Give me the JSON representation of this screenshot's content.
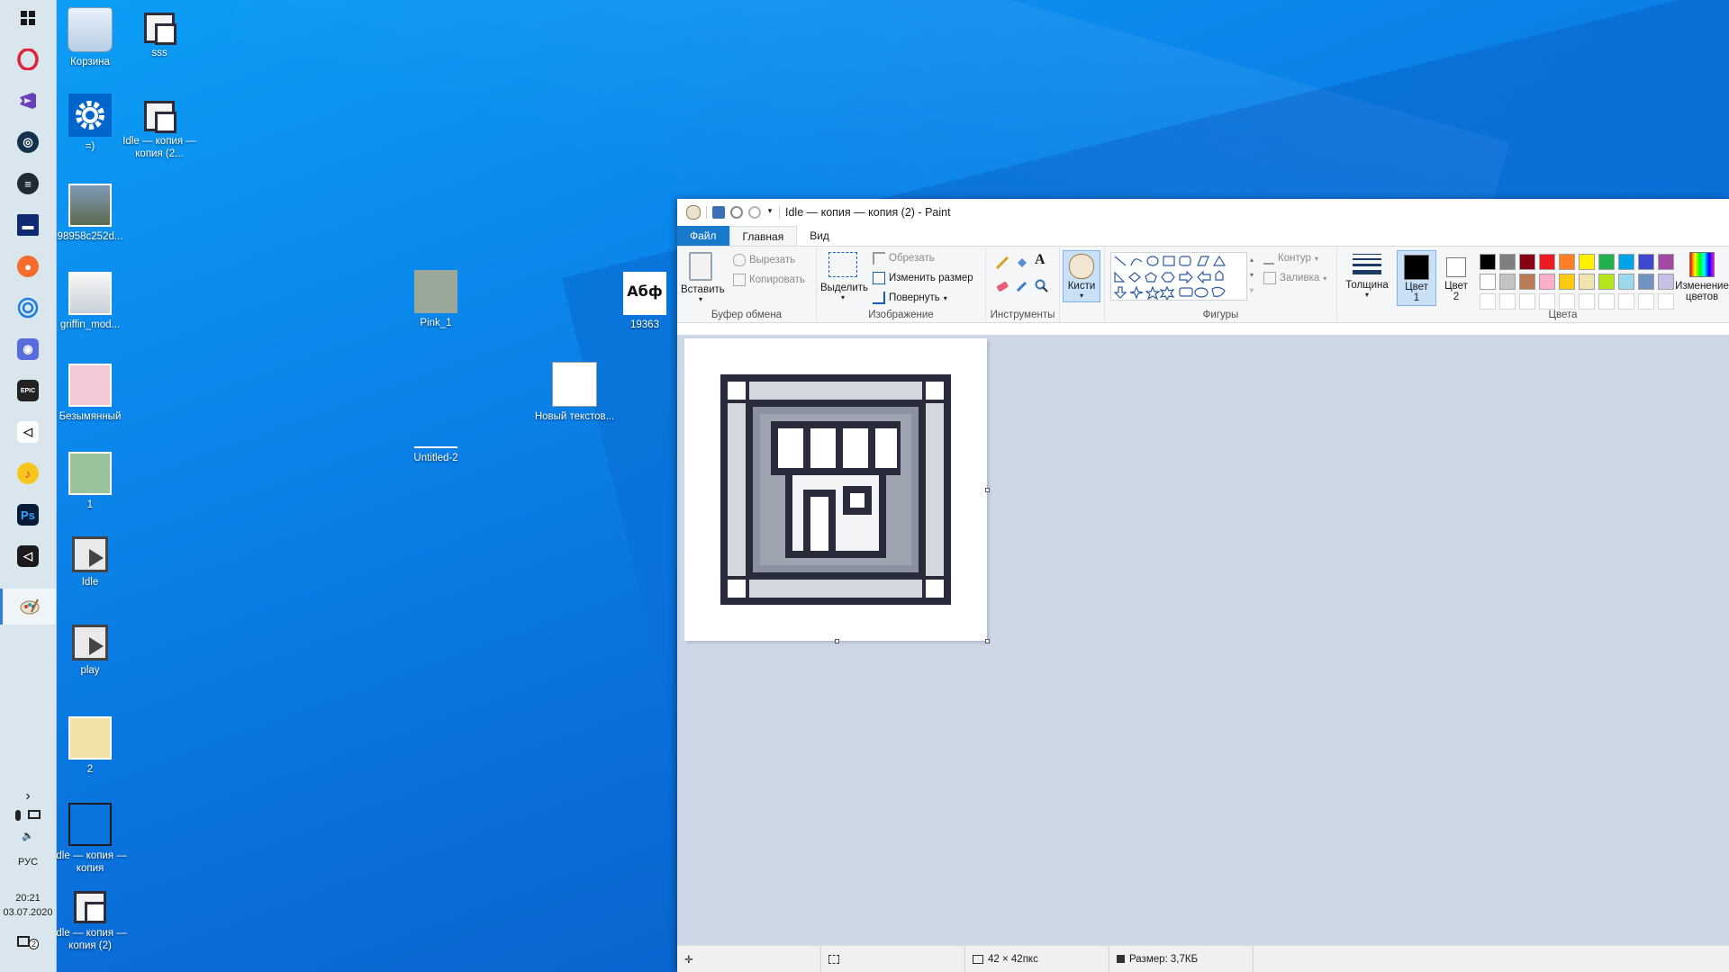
{
  "taskbar": {
    "apps": [
      "windows-start",
      "opera",
      "visual-studio",
      "steam",
      "app-stripes",
      "app-bar",
      "origin",
      "ubisoft",
      "discord",
      "epic-games",
      "unity",
      "yandex-music",
      "photoshop",
      "unity-hub",
      "paint"
    ],
    "epic_label": "EPIC",
    "ps_label": "Ps",
    "tray_chevron": "›",
    "lang": "РУС",
    "time": "20:21",
    "date": "03.07.2020",
    "notification_count": "2"
  },
  "desktop": {
    "icons": [
      {
        "label": "Корзина",
        "icon": "recycle-bin-icon"
      },
      {
        "label": "sss",
        "icon": "shop-file-icon"
      },
      {
        "label": "=)",
        "icon": "settings-gear-icon"
      },
      {
        "label": "Idle — копия — копия (2...",
        "icon": "shop-file-icon"
      },
      {
        "label": "98958c252d...",
        "icon": "photo-icon"
      },
      {
        "label": "griffin_mod...",
        "icon": "car-image-icon"
      },
      {
        "label": "Безымянный",
        "icon": "pink-image-icon"
      },
      {
        "label": "1",
        "icon": "green-image-icon"
      },
      {
        "label": "Idle",
        "icon": "play-file-icon"
      },
      {
        "label": "play",
        "icon": "play-file-icon"
      },
      {
        "label": "2",
        "icon": "yellow-image-icon"
      },
      {
        "label": "Idle — копия — копия",
        "icon": "blank-frame-icon"
      },
      {
        "label": "Idle — копия — копия (2)",
        "icon": "shop-file-icon"
      },
      {
        "label": "Pink_1",
        "icon": "texture-image-icon"
      },
      {
        "label": "Untitled-2",
        "icon": "blank-image-icon"
      },
      {
        "label": "Новый текстов...",
        "icon": "text-document-icon"
      },
      {
        "label": "19363",
        "icon": "font-file-icon"
      }
    ],
    "font_preview": "Абф"
  },
  "paint": {
    "title": "Idle — копия — копия (2) - Paint",
    "tabs": {
      "file": "Файл",
      "home": "Главная",
      "view": "Вид"
    },
    "clipboard": {
      "paste": "Вставить",
      "cut": "Вырезать",
      "copy": "Копировать",
      "label": "Буфер обмена"
    },
    "image": {
      "select": "Выделить",
      "crop": "Обрезать",
      "resize": "Изменить размер",
      "rotate": "Повернуть",
      "label": "Изображение"
    },
    "tools": {
      "label": "Инструменты",
      "brushes": "Кисти"
    },
    "shapes": {
      "label": "Фигуры",
      "outline": "Контур",
      "fill": "Заливка"
    },
    "thickness": "Толщина",
    "colors": {
      "color1": "Цвет 1",
      "color2": "Цвет 2",
      "edit": "Изменение цветов",
      "label": "Цвета",
      "palette_row1": [
        "#000000",
        "#7f7f7f",
        "#880015",
        "#ed1c24",
        "#ff7f27",
        "#fff200",
        "#22b14c",
        "#00a2e8",
        "#3f48cc",
        "#a349a4"
      ],
      "palette_row2": [
        "#ffffff",
        "#c3c3c3",
        "#b97a57",
        "#ffaec9",
        "#ffc90e",
        "#efe4b0",
        "#b5e61d",
        "#99d9ea",
        "#7092be",
        "#c8bfe7"
      ],
      "palette_row3": [
        "#ffffff",
        "#ffffff",
        "#ffffff",
        "#ffffff",
        "#ffffff",
        "#ffffff",
        "#ffffff",
        "#ffffff",
        "#ffffff",
        "#ffffff"
      ],
      "primary": "#000000",
      "secondary": "#ffffff"
    },
    "status": {
      "dimensions": "42 × 42пкс",
      "size": "Размер: 3,7КБ"
    }
  }
}
